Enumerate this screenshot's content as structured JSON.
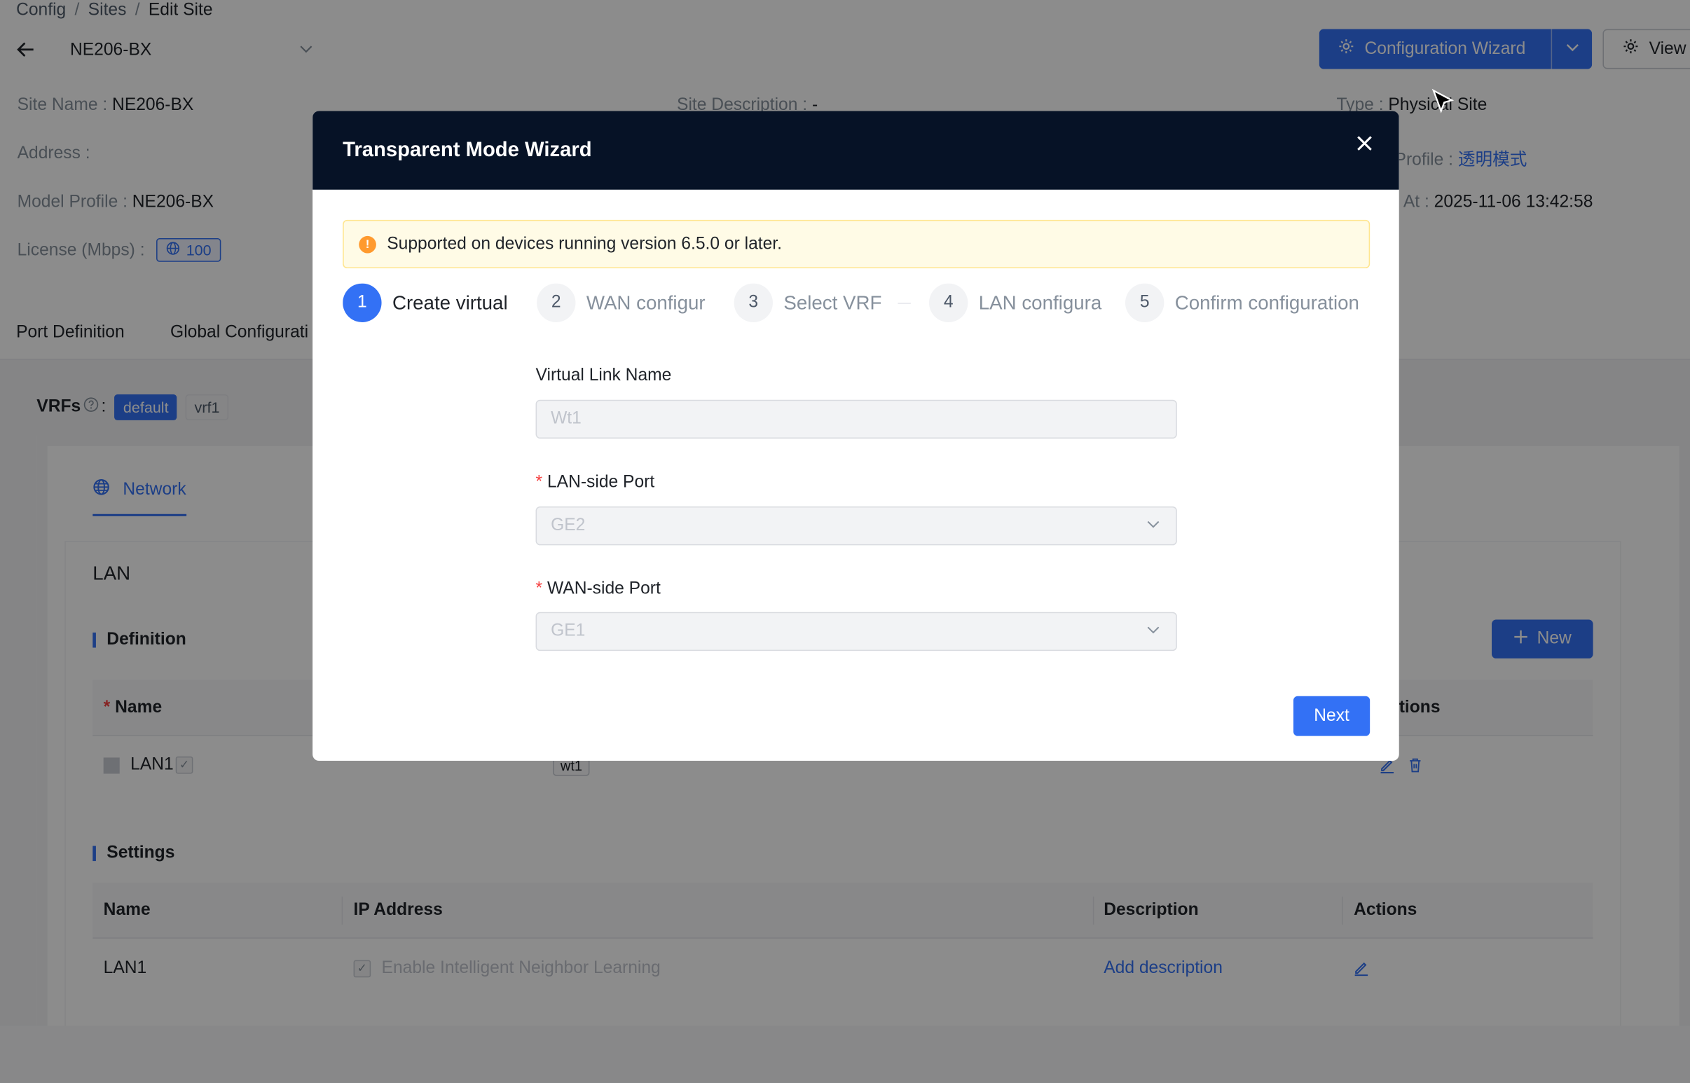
{
  "breadcrumb": {
    "items": [
      "Config",
      "Sites"
    ],
    "current": "Edit Site",
    "separator": "/"
  },
  "header": {
    "site_name": "NE206-BX",
    "wizard_button": "Configuration Wizard",
    "view_button": "View"
  },
  "site_info": {
    "site_name_label": "Site Name :",
    "site_name_value": "NE206-BX",
    "site_desc_label": "Site Description :",
    "site_desc_value": "-",
    "type_label": "Type :",
    "type_value": "Physical Site",
    "address_label": "Address :",
    "profile_label": "Profile :",
    "profile_value": "透明模式",
    "model_profile_label": "Model Profile :",
    "model_profile_value": "NE206-BX",
    "created_label": "At :",
    "created_value": "2025-11-06 13:42:58",
    "license_label": "License (Mbps) :",
    "license_value": "100"
  },
  "tabs": [
    "Port Definition",
    "Global Configurati"
  ],
  "vrfs": {
    "label": "VRFs",
    "items": [
      "default",
      "vrf1"
    ]
  },
  "network_tab": "Network",
  "lan": {
    "title": "LAN",
    "definition_title": "Definition",
    "new_button": "New",
    "def_headers": {
      "name": "Name",
      "actions": "tions"
    },
    "def_row": {
      "name": "LAN1",
      "port": "wt1"
    },
    "settings_title": "Settings",
    "settings_headers": [
      "Name",
      "IP Address",
      "Description",
      "Actions"
    ],
    "settings_row": {
      "name": "LAN1",
      "ip": "Enable Intelligent Neighbor Learning",
      "description": "Add description"
    }
  },
  "modal": {
    "title": "Transparent Mode Wizard",
    "alert": "Supported on devices running version 6.5.0 or later.",
    "steps": [
      {
        "num": "1",
        "label": "Create virtual"
      },
      {
        "num": "2",
        "label": "WAN configur"
      },
      {
        "num": "3",
        "label": "Select VRF"
      },
      {
        "num": "4",
        "label": "LAN configura"
      },
      {
        "num": "5",
        "label": "Confirm configuration"
      }
    ],
    "fields": {
      "virtual_link_label": "Virtual Link Name",
      "virtual_link_placeholder": "Wt1",
      "lan_port_label": "LAN-side Port",
      "lan_port_value": "GE2",
      "wan_port_label": "WAN-side Port",
      "wan_port_value": "GE1",
      "required_mark": "*"
    },
    "next_button": "Next"
  },
  "colors": {
    "primary": "#3371f5",
    "modal_header": "#061226",
    "warning": "#ff9a2e"
  }
}
